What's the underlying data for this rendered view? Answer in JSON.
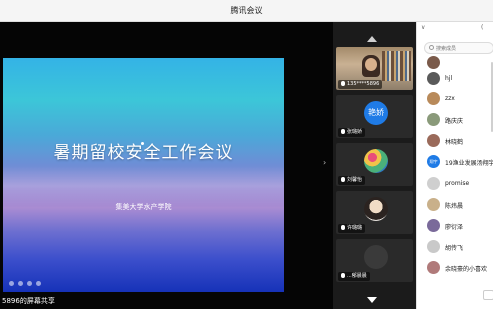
{
  "window": {
    "title": "腾讯会议"
  },
  "slide": {
    "headline": "暑期留校安全工作会议",
    "organization": "集美大学水产学院"
  },
  "share_caption": "5896的屏幕共享",
  "video_tiles": [
    {
      "label": "135****5896",
      "kind": "camera"
    },
    {
      "label": "张璐娇",
      "kind": "text-avatar",
      "avatar_text": "艳娇"
    },
    {
      "label": "刘馨怡",
      "kind": "image-avatar",
      "style": "flower"
    },
    {
      "label": "许璐璐",
      "kind": "image-avatar",
      "style": "girl"
    },
    {
      "label": "...郁晨晨",
      "kind": "image-avatar",
      "style": "dark"
    }
  ],
  "sidebar": {
    "count": "(",
    "search_placeholder": "搜索成员",
    "members": [
      {
        "name": "",
        "avatar": "photo",
        "color": "#7a5a4a"
      },
      {
        "name": "hjl",
        "avatar": "photo",
        "color": "#5a5a5a"
      },
      {
        "name": "zzx",
        "avatar": "photo",
        "color": "#b88a5a"
      },
      {
        "name": "路庆庆",
        "avatar": "photo",
        "color": "#8a9a7a"
      },
      {
        "name": "林晓鹤",
        "avatar": "photo",
        "color": "#9a6a5a"
      },
      {
        "name": "19渔业发展汤翔宇",
        "avatar": "text",
        "avatar_text": "翔宇",
        "color": "#1f7be6"
      },
      {
        "name": "promise",
        "avatar": "gray",
        "color": "#cfcfcf"
      },
      {
        "name": "陈炜晨",
        "avatar": "photo",
        "color": "#c9b08a"
      },
      {
        "name": "廖衍泽",
        "avatar": "photo",
        "color": "#7a6a9a"
      },
      {
        "name": "胡传飞",
        "avatar": "photo",
        "color": "#c9c9c9"
      },
      {
        "name": "余晓豪的小喜欢",
        "avatar": "photo",
        "color": "#b07a7a"
      }
    ]
  }
}
